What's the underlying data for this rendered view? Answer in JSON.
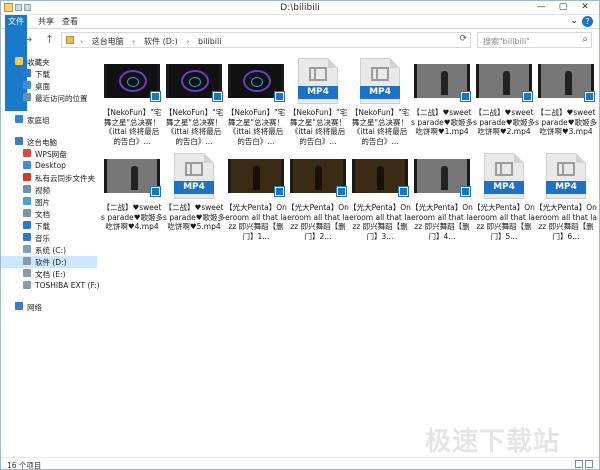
{
  "window": {
    "title": "D:\\bilibili",
    "min": "—",
    "max": "▢",
    "close": "✕"
  },
  "ribbon": {
    "file": "文件",
    "share": "共享",
    "view": "查看"
  },
  "nav": {
    "back": "←",
    "forward": "→",
    "up": "↑",
    "crumbs": [
      "这台电脑",
      "软件 (D:)",
      "bilibili"
    ],
    "search_placeholder": "搜索\"bilibili\""
  },
  "sidebar": {
    "items": [
      {
        "label": "收藏夹",
        "color": "#f3c94a"
      },
      {
        "label": "下载",
        "color": "#2a78cf"
      },
      {
        "label": "桌面",
        "color": "#3a8de0"
      },
      {
        "label": "最近访问的位置",
        "color": "#6b8fb3"
      },
      {
        "label": "家庭组",
        "color": "#2b8bd8"
      },
      {
        "label": "这台电脑",
        "color": "#3b7dc4"
      },
      {
        "label": "WPS网盘",
        "color": "#d94a3a"
      },
      {
        "label": "Desktop",
        "color": "#3a8de0"
      },
      {
        "label": "私有云同步文件夹",
        "color": "#d23a2a"
      },
      {
        "label": "视频",
        "color": "#6f8fb0"
      },
      {
        "label": "图片",
        "color": "#4b9fd8"
      },
      {
        "label": "文档",
        "color": "#7a93ad"
      },
      {
        "label": "下载",
        "color": "#2a78cf"
      },
      {
        "label": "音乐",
        "color": "#2a78cf"
      },
      {
        "label": "系统 (C:)",
        "color": "#7da2c7"
      },
      {
        "label": "软件 (D:)",
        "color": "#8a9aab"
      },
      {
        "label": "文档 (E:)",
        "color": "#8a9aab"
      },
      {
        "label": "TOSHIBA EXT (F:)",
        "color": "#8a9aab"
      },
      {
        "label": "网络",
        "color": "#3b7dc4"
      }
    ]
  },
  "files": [
    {
      "name": "【NekoFun】\"宅舞之星\"总决赛！《ittai 终将最后的告白》...",
      "kind": "video-logo"
    },
    {
      "name": "【NekoFun】\"宅舞之星\"总决赛！《ittai 终将最后的告白》...",
      "kind": "video-logo"
    },
    {
      "name": "【NekoFun】\"宅舞之星\"总决赛！《ittai 终将最后的告白》...",
      "kind": "video-logo"
    },
    {
      "name": "【NekoFun】\"宅舞之星\"总决赛！《ittai 终将最后的告白》...",
      "kind": "mp4"
    },
    {
      "name": "【NekoFun】\"宅舞之星\"总决赛！《ittai 终将最后的告白》...",
      "kind": "mp4"
    },
    {
      "name": "【二战】♥sweets parade♥歌姬多吃饼啊♥1.mp4",
      "kind": "video-dance"
    },
    {
      "name": "【二战】♥sweets parade♥歌姬多吃饼啊♥2.mp4",
      "kind": "video-dance"
    },
    {
      "name": "【二战】♥sweets parade♥歌姬多吃饼啊♥3.mp4",
      "kind": "video-dance"
    },
    {
      "name": "【二战】♥sweets parade♥歌姬多吃饼啊♥4.mp4",
      "kind": "video-dance"
    },
    {
      "name": "【二战】♥sweets parade♥歌姬多吃饼啊♥5.mp4",
      "kind": "mp4"
    },
    {
      "name": "【光大Penta】Oneroom all that lazz 即兴舞蹈【删门】1...",
      "kind": "video-dark"
    },
    {
      "name": "【光大Penta】Oneroom all that lazz 即兴舞蹈【删门】2...",
      "kind": "video-dark"
    },
    {
      "name": "【光大Penta】Oneroom all that lazz 即兴舞蹈【删门】3...",
      "kind": "video-dark"
    },
    {
      "name": "【光大Penta】Oneroom all that lazz 即兴舞蹈【删门】4...",
      "kind": "video-dance"
    },
    {
      "name": "【光大Penta】Oneroom all that lazz 即兴舞蹈【删门】5...",
      "kind": "mp4"
    },
    {
      "name": "【光大Penta】Oneroom all that lazz 即兴舞蹈【删门】6...",
      "kind": "mp4"
    }
  ],
  "mp4_label": "MP4",
  "status": {
    "count": "16 个项目"
  },
  "watermark": "极速下载站"
}
